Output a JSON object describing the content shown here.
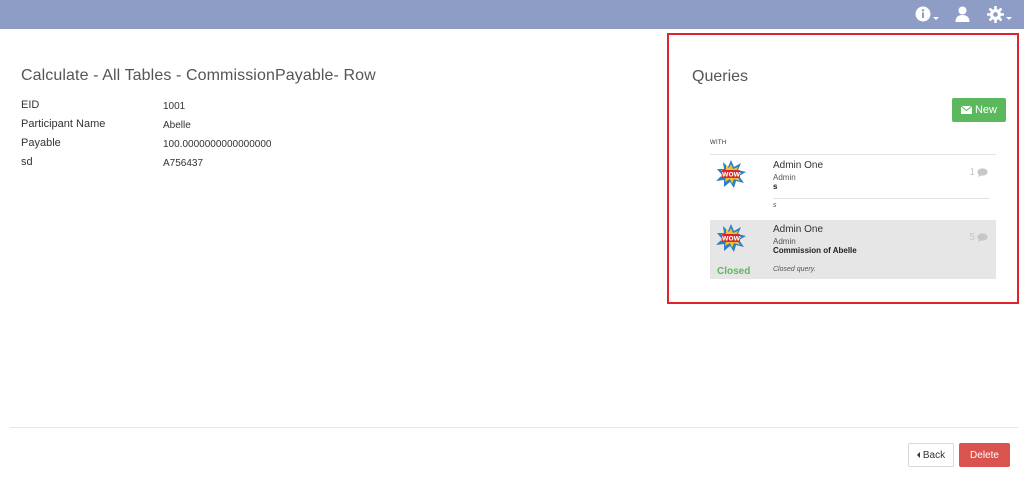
{
  "header": {
    "icons": [
      "info-icon",
      "user-icon",
      "gear-icon"
    ]
  },
  "record": {
    "title": "Calculate - All Tables - CommissionPayable- Row",
    "fields": [
      {
        "label": "EID",
        "value": "1001"
      },
      {
        "label": "Participant Name",
        "value": "Abelle"
      },
      {
        "label": "Payable",
        "value": "100.0000000000000000"
      },
      {
        "label": "sd",
        "value": "A756437"
      }
    ]
  },
  "queries": {
    "title": "Queries",
    "new_label": "New",
    "with_label": "WITH",
    "items": [
      {
        "author": "Admin One",
        "role": "Admin",
        "subject": "s",
        "message": "s",
        "count": "1",
        "status": ""
      },
      {
        "author": "Admin One",
        "role": "Admin",
        "subject": "Commission of Abelle",
        "message": "Closed query.",
        "count": "5",
        "status": "Closed"
      }
    ]
  },
  "footer": {
    "back_label": "Back",
    "delete_label": "Delete"
  },
  "colors": {
    "header_bar": "#8e9dc6",
    "highlight_border": "#e0232b",
    "new_button": "#5cb85c",
    "delete_button": "#d9534f",
    "closed_status": "#5cb85c"
  }
}
